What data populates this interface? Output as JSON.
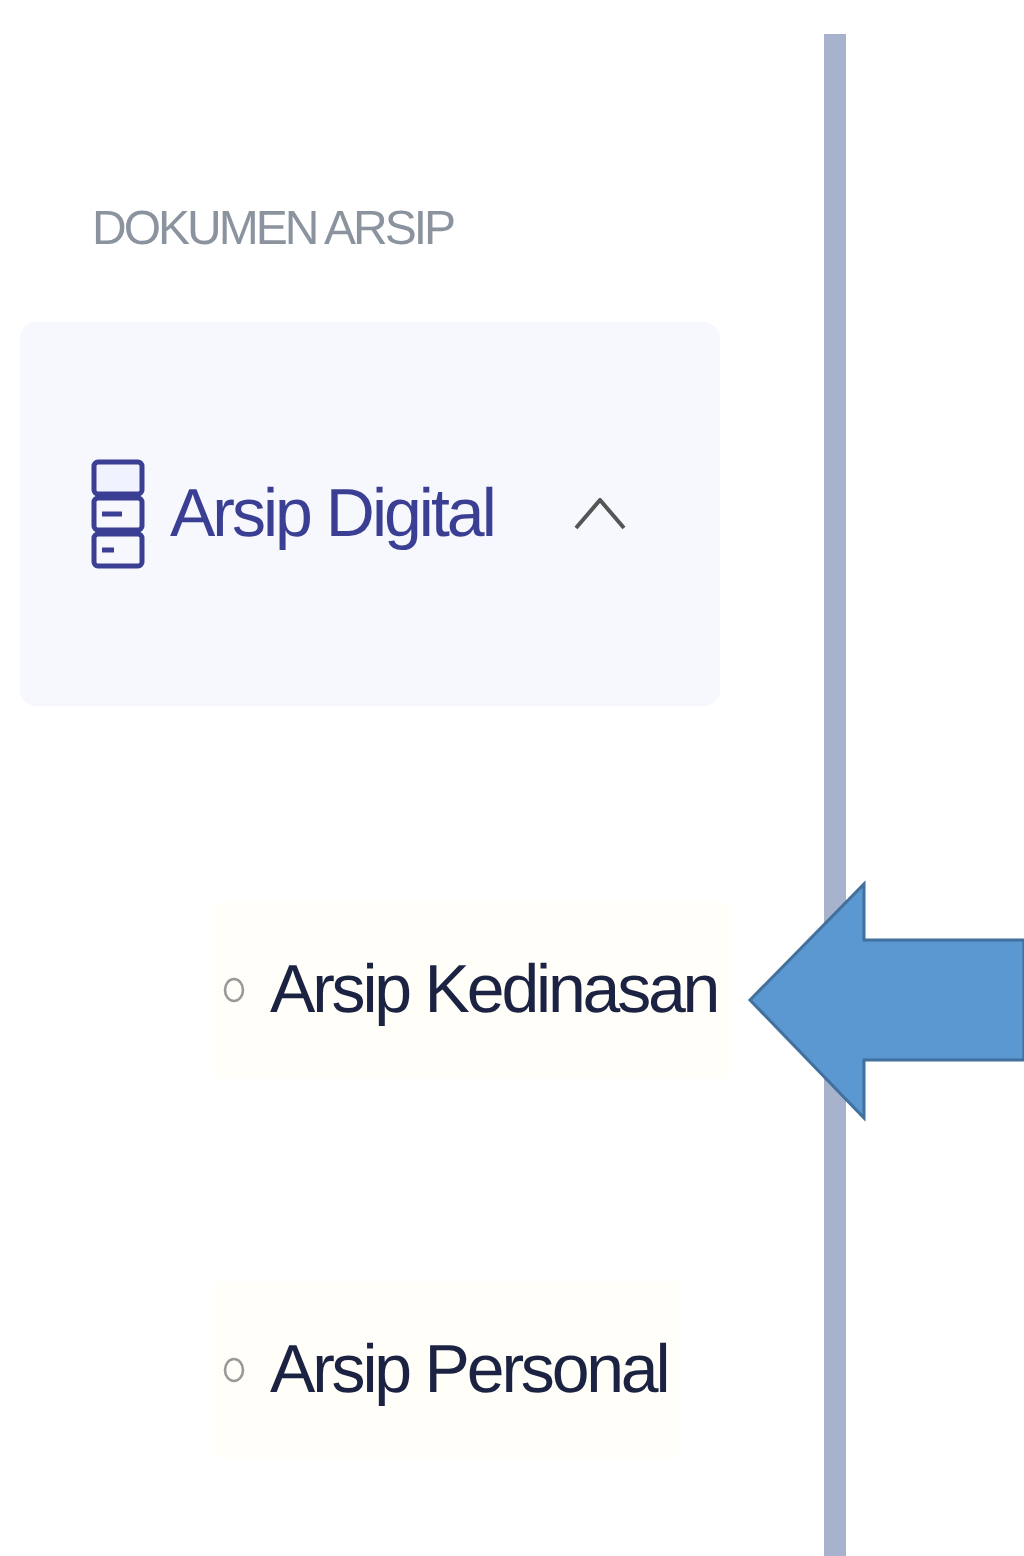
{
  "sidebar": {
    "section_title": "DOKUMEN ARSIP",
    "menu": {
      "label": "Arsip Digital",
      "expanded": true,
      "children": [
        {
          "label": "Arsip Kedinasan"
        },
        {
          "label": "Arsip Personal"
        }
      ]
    }
  }
}
